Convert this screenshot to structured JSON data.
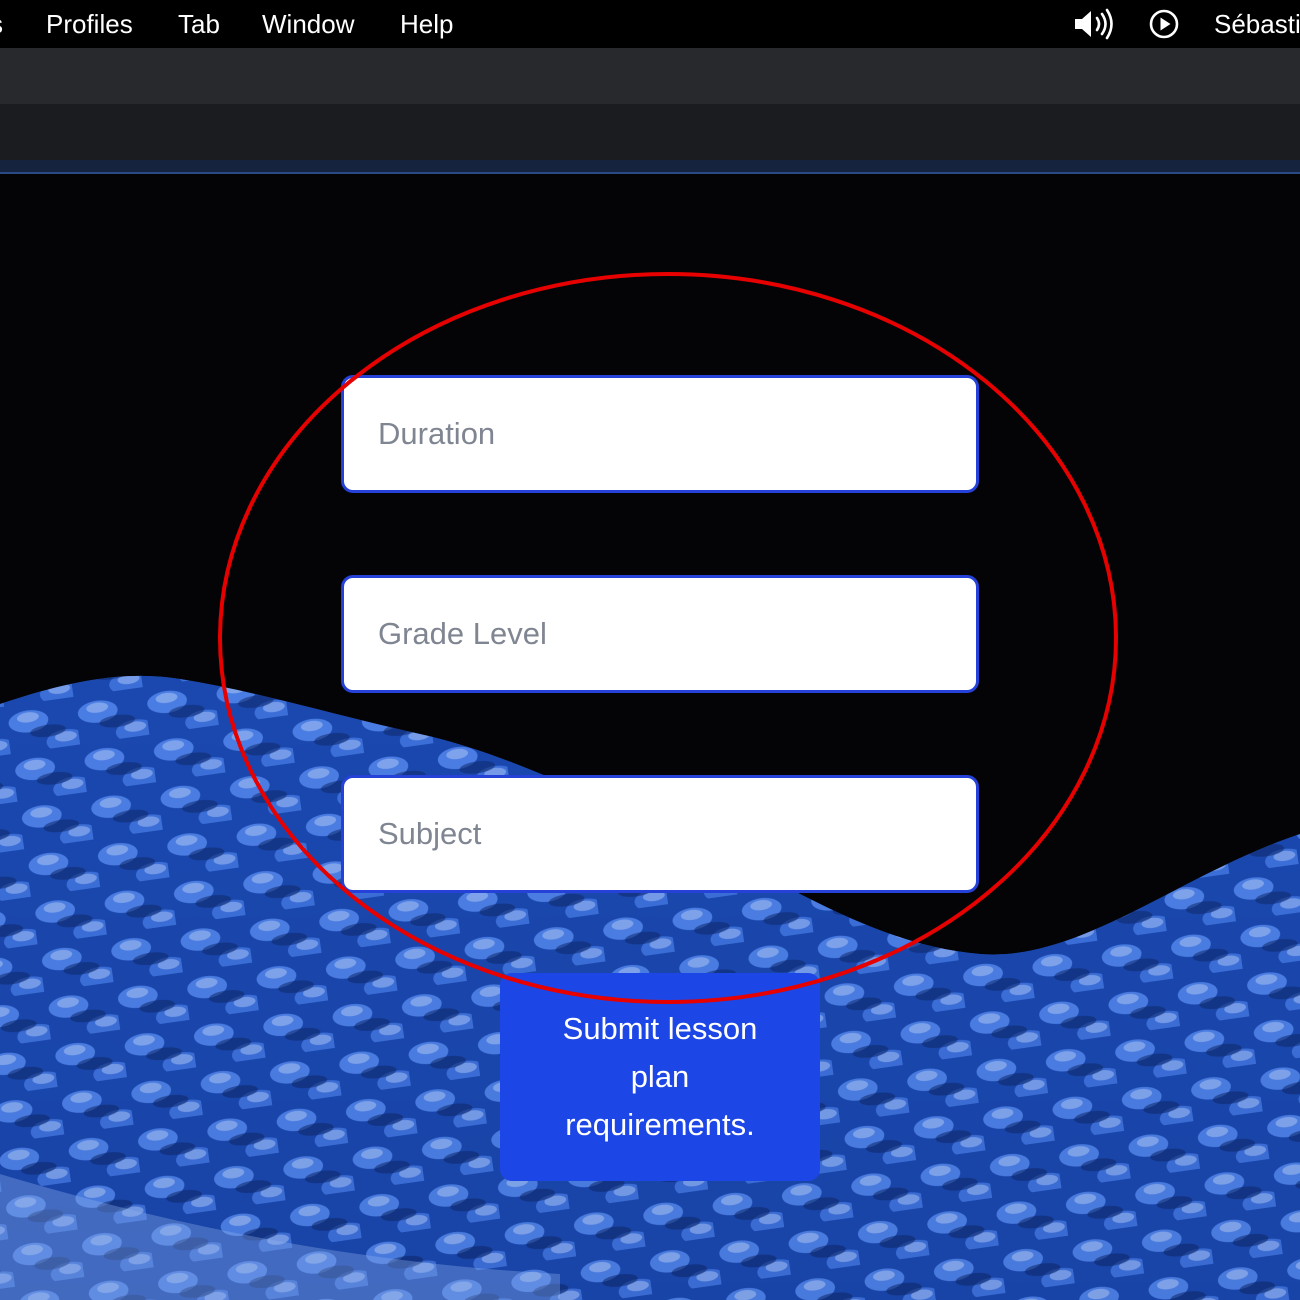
{
  "menubar": {
    "clipped_item": "s",
    "items": [
      "Profiles",
      "Tab",
      "Window",
      "Help"
    ],
    "status_icons": [
      "volume-icon",
      "play-circle-icon"
    ],
    "user_name": "Sébasti"
  },
  "form": {
    "fields": [
      {
        "placeholder": "Duration",
        "value": ""
      },
      {
        "placeholder": "Grade Level",
        "value": ""
      },
      {
        "placeholder": "Subject",
        "value": ""
      }
    ],
    "submit_label": "Submit lesson plan requirements."
  },
  "colors": {
    "accent": "#2541d8",
    "button": "#1d46e6",
    "annotation": "#e60000",
    "background": "#040406"
  }
}
